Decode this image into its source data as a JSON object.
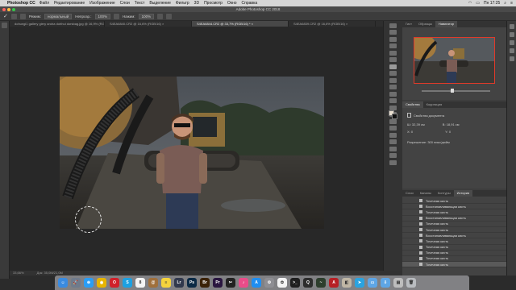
{
  "menubar": {
    "app": "Photoshop CC",
    "items": [
      "Файл",
      "Редактирование",
      "Изображение",
      "Слои",
      "Текст",
      "Выделение",
      "Фильтр",
      "3D",
      "Просмотр",
      "Окно",
      "Справка"
    ],
    "clock": "Пн 17:25"
  },
  "titlebar": {
    "title": "Adobe Photoshop CC 2018"
  },
  "options": {
    "mode_label": "Режим:",
    "mode_value": "нормальный",
    "opacity_label": "Непрозр.:",
    "opacity_value": "100%",
    "flow_label": "Нажим:",
    "flow_value": "100%"
  },
  "tabs": [
    {
      "label": "dohungi1 gallery giery aroha dohhui dorsbag.jpg @ 16,9% (RGB/8) ×",
      "active": false
    },
    {
      "label": "S4EA6840.CR2 @ 16,6% (RGB/16) ×",
      "active": false
    },
    {
      "label": "S4EA6844.CR2 @ 33,7% (RGB/16) * ×",
      "active": true
    },
    {
      "label": "S4EA6839.CR2 @ 16,6% (RGB/16) ×",
      "active": false
    }
  ],
  "status": {
    "zoom": "33,66%",
    "doc": "Док: 35,0М/21,0М"
  },
  "panels": {
    "top_tabs": [
      "Гист",
      "Образцы",
      "Навигатор"
    ],
    "prop_tabs": [
      "Свойства",
      "Коррекция"
    ],
    "prop_title": "Свойства документа",
    "w_label": "Ш:",
    "w_value": "32,39 см",
    "h_label": "В:",
    "h_value": "18,91 см",
    "x_label": "X:",
    "x_value": "0",
    "y_label": "Y:",
    "y_value": "0",
    "res_text": "Разрешение: 300 пикс/дюйм",
    "bottom_tabs": [
      "Слои",
      "Каналы",
      "Контуры",
      "История"
    ],
    "history_items": [
      "Точечная кисть",
      "Восстанавливающая кисть",
      "Точечная кисть",
      "Восстанавливающая кисть",
      "Точечная кисть",
      "Точечная кисть",
      "Восстанавливающая кисть",
      "Точечная кисть",
      "Точечная кисть",
      "Точечная кисть",
      "Точечная кисть",
      "Точечная кисть"
    ]
  },
  "dock": {
    "icons": [
      {
        "name": "finder-icon",
        "color": "#3a8be0",
        "glyph": "☺"
      },
      {
        "name": "launchpad-icon",
        "color": "#6f7b8c",
        "glyph": "🚀"
      },
      {
        "name": "safari-icon",
        "color": "#2a9df4",
        "glyph": "⊕"
      },
      {
        "name": "chrome-icon",
        "color": "#e6b400",
        "glyph": "◉"
      },
      {
        "name": "opera-icon",
        "color": "#d0202a",
        "glyph": "O"
      },
      {
        "name": "skype-icon",
        "color": "#1da1e2",
        "glyph": "S"
      },
      {
        "name": "calendar-icon",
        "color": "#f4f4f4",
        "glyph": "8"
      },
      {
        "name": "contacts-icon",
        "color": "#a0703c",
        "glyph": "@"
      },
      {
        "name": "notes-icon",
        "color": "#f5d33c",
        "glyph": "≡"
      },
      {
        "name": "lightroom-icon",
        "color": "#31394d",
        "glyph": "Lr"
      },
      {
        "name": "photoshop-icon",
        "color": "#0b2a45",
        "glyph": "Ps"
      },
      {
        "name": "bridge-icon",
        "color": "#3b2208",
        "glyph": "Br"
      },
      {
        "name": "premiere-icon",
        "color": "#2a1640",
        "glyph": "Pr"
      },
      {
        "name": "finalcut-icon",
        "color": "#222",
        "glyph": "✂"
      },
      {
        "name": "itunes-icon",
        "color": "#ea4c89",
        "glyph": "♪"
      },
      {
        "name": "appstore-icon",
        "color": "#1f8ef1",
        "glyph": "A"
      },
      {
        "name": "settings-icon",
        "color": "#8e8e93",
        "glyph": "⚙"
      },
      {
        "name": "photos-icon",
        "color": "#f4f4f4",
        "glyph": "✿"
      },
      {
        "name": "terminal-icon",
        "color": "#1f1f1f",
        "glyph": ">_"
      },
      {
        "name": "quicktime-icon",
        "color": "#2d2d2d",
        "glyph": "Q"
      },
      {
        "name": "activity-icon",
        "color": "#2d3e2d",
        "glyph": "~"
      },
      {
        "name": "pdf-icon",
        "color": "#b72025",
        "glyph": "A"
      },
      {
        "name": "preview-icon",
        "color": "#bfb6a5",
        "glyph": "◧"
      },
      {
        "name": "telegram-icon",
        "color": "#2aa3e0",
        "glyph": "➤"
      },
      {
        "name": "folder-icon",
        "color": "#5ea6e6",
        "glyph": "▭"
      },
      {
        "name": "downloads-icon",
        "color": "#5ea6e6",
        "glyph": "⇩"
      },
      {
        "name": "documents-icon",
        "color": "#bdbdbd",
        "glyph": "▤"
      },
      {
        "name": "trash-icon",
        "color": "#b9bcc0",
        "glyph": "🗑"
      }
    ]
  }
}
